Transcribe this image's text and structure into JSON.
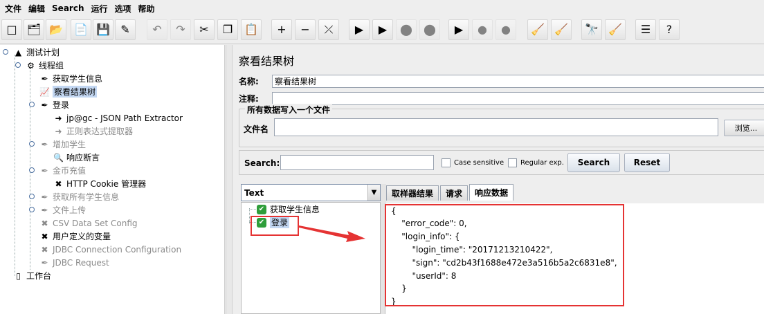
{
  "menu": [
    "文件",
    "编辑",
    "Search",
    "运行",
    "选项",
    "帮助"
  ],
  "toolbar": [
    {
      "icon": "new-file-icon",
      "glyph": "□",
      "disabled": false
    },
    {
      "icon": "open-templates-icon",
      "glyph": "🗂",
      "disabled": false
    },
    {
      "icon": "open-folder-icon",
      "glyph": "📂",
      "disabled": false
    },
    {
      "icon": "close-file-icon",
      "glyph": "📄",
      "disabled": false
    },
    {
      "icon": "save-icon",
      "glyph": "💾",
      "disabled": false
    },
    {
      "icon": "save-as-icon",
      "glyph": "✎",
      "disabled": false
    },
    {
      "icon": "undo-icon",
      "glyph": "↶",
      "disabled": true
    },
    {
      "icon": "redo-icon",
      "glyph": "↷",
      "disabled": true
    },
    {
      "icon": "cut-icon",
      "glyph": "✂",
      "disabled": false
    },
    {
      "icon": "copy-icon",
      "glyph": "❐",
      "disabled": false
    },
    {
      "icon": "paste-icon",
      "glyph": "📋",
      "disabled": false
    },
    {
      "icon": "expand-icon",
      "glyph": "+",
      "disabled": false
    },
    {
      "icon": "collapse-icon",
      "glyph": "−",
      "disabled": false
    },
    {
      "icon": "toggle-icon",
      "glyph": "⤫",
      "disabled": false
    },
    {
      "icon": "start-icon",
      "glyph": "▶",
      "disabled": false
    },
    {
      "icon": "start-no-pause-icon",
      "glyph": "▶",
      "disabled": false
    },
    {
      "icon": "stop-icon",
      "glyph": "⬤",
      "disabled": true
    },
    {
      "icon": "shutdown-icon",
      "glyph": "⬤",
      "disabled": true
    },
    {
      "icon": "remote-start-icon",
      "glyph": "▶",
      "disabled": false
    },
    {
      "icon": "remote-stop-icon",
      "glyph": "●",
      "disabled": true
    },
    {
      "icon": "remote-exit-icon",
      "glyph": "●",
      "disabled": true
    },
    {
      "icon": "clear-icon",
      "glyph": "🧹",
      "disabled": false
    },
    {
      "icon": "clear-all-icon",
      "glyph": "🧹",
      "disabled": false
    },
    {
      "icon": "binoculars-search-icon",
      "glyph": "🔭",
      "disabled": false
    },
    {
      "icon": "broom-reset-icon",
      "glyph": "🧹",
      "disabled": false
    },
    {
      "icon": "function-helper-icon",
      "glyph": "☰",
      "disabled": false
    },
    {
      "icon": "help-icon",
      "glyph": "?",
      "disabled": false
    }
  ],
  "tree": [
    {
      "label": "测试计划",
      "icon": "test-plan-icon",
      "glyph": "▲",
      "dim": false,
      "selected": false
    },
    {
      "label": "线程组",
      "icon": "thread-group-icon",
      "glyph": "⚙",
      "dim": false,
      "selected": false
    },
    {
      "label": "获取学生信息",
      "icon": "sampler-pen-icon",
      "glyph": "✒",
      "dim": false,
      "selected": false
    },
    {
      "label": "察看结果树",
      "icon": "listener-chart-icon",
      "glyph": "📈",
      "dim": false,
      "selected": true
    },
    {
      "label": "登录",
      "icon": "sampler-pen-icon",
      "glyph": "✒",
      "dim": false,
      "selected": false
    },
    {
      "label": "jp@gc - JSON Path Extractor",
      "icon": "extractor-arrow-icon",
      "glyph": "➜",
      "dim": false,
      "selected": false
    },
    {
      "label": "正则表达式提取器",
      "icon": "extractor-arrow-icon",
      "glyph": "➜",
      "dim": true,
      "selected": false
    },
    {
      "label": "增加学生",
      "icon": "sampler-pen-icon",
      "glyph": "✒",
      "dim": true,
      "selected": false
    },
    {
      "label": "响应断言",
      "icon": "magnifier-assertion-icon",
      "glyph": "🔍",
      "dim": false,
      "selected": false
    },
    {
      "label": "金币充值",
      "icon": "sampler-pen-icon",
      "glyph": "✒",
      "dim": true,
      "selected": false
    },
    {
      "label": "HTTP Cookie 管理器",
      "icon": "config-tools-icon",
      "glyph": "✖",
      "dim": false,
      "selected": false
    },
    {
      "label": "获取所有学生信息",
      "icon": "sampler-pen-icon",
      "glyph": "✒",
      "dim": true,
      "selected": false
    },
    {
      "label": "文件上传",
      "icon": "sampler-pen-icon",
      "glyph": "✒",
      "dim": true,
      "selected": false
    },
    {
      "label": "CSV Data Set Config",
      "icon": "config-tools-icon",
      "glyph": "✖",
      "dim": true,
      "selected": false
    },
    {
      "label": "用户定义的变量",
      "icon": "config-tools-icon",
      "glyph": "✖",
      "dim": false,
      "selected": false
    },
    {
      "label": "JDBC Connection Configuration",
      "icon": "config-tools-icon",
      "glyph": "✖",
      "dim": true,
      "selected": false
    },
    {
      "label": "JDBC Request",
      "icon": "sampler-pen-icon",
      "glyph": "✒",
      "dim": true,
      "selected": false
    },
    {
      "label": "工作台",
      "icon": "workbench-icon",
      "glyph": "▯",
      "dim": false,
      "selected": false
    }
  ],
  "panel": {
    "title": "察看结果树",
    "name_label": "名称:",
    "name_value": "察看结果树",
    "comment_label": "注释:",
    "comment_value": "",
    "file_group_title": "所有数据写入一个文件",
    "filename_label": "文件名",
    "filename_value": "",
    "browse_label": "浏览..."
  },
  "search": {
    "label": "Search:",
    "value": "",
    "case_sensitive": "Case sensitive",
    "regular_exp": "Regular exp.",
    "search_button": "Search",
    "reset_button": "Reset"
  },
  "results": {
    "renderer": "Text",
    "items": [
      {
        "label": "获取学生信息",
        "status": "success"
      },
      {
        "label": "登录",
        "status": "success"
      }
    ]
  },
  "tabs": [
    {
      "label": "取样器结果",
      "active": false
    },
    {
      "label": "请求",
      "active": false
    },
    {
      "label": "响应数据",
      "active": true
    }
  ],
  "response_lines": [
    "{",
    "    \"error_code\": 0,",
    "    \"login_info\": {",
    "        \"login_time\": \"20171213210422\",",
    "        \"sign\": \"cd2b43f1688e472e3a516b5a2c6831e8\",",
    "        \"userId\": 8",
    "    }",
    "}"
  ],
  "colors": {
    "highlight_red": "#e53333",
    "selection": "#c3d7f2",
    "success_green": "#2f9e3a"
  }
}
